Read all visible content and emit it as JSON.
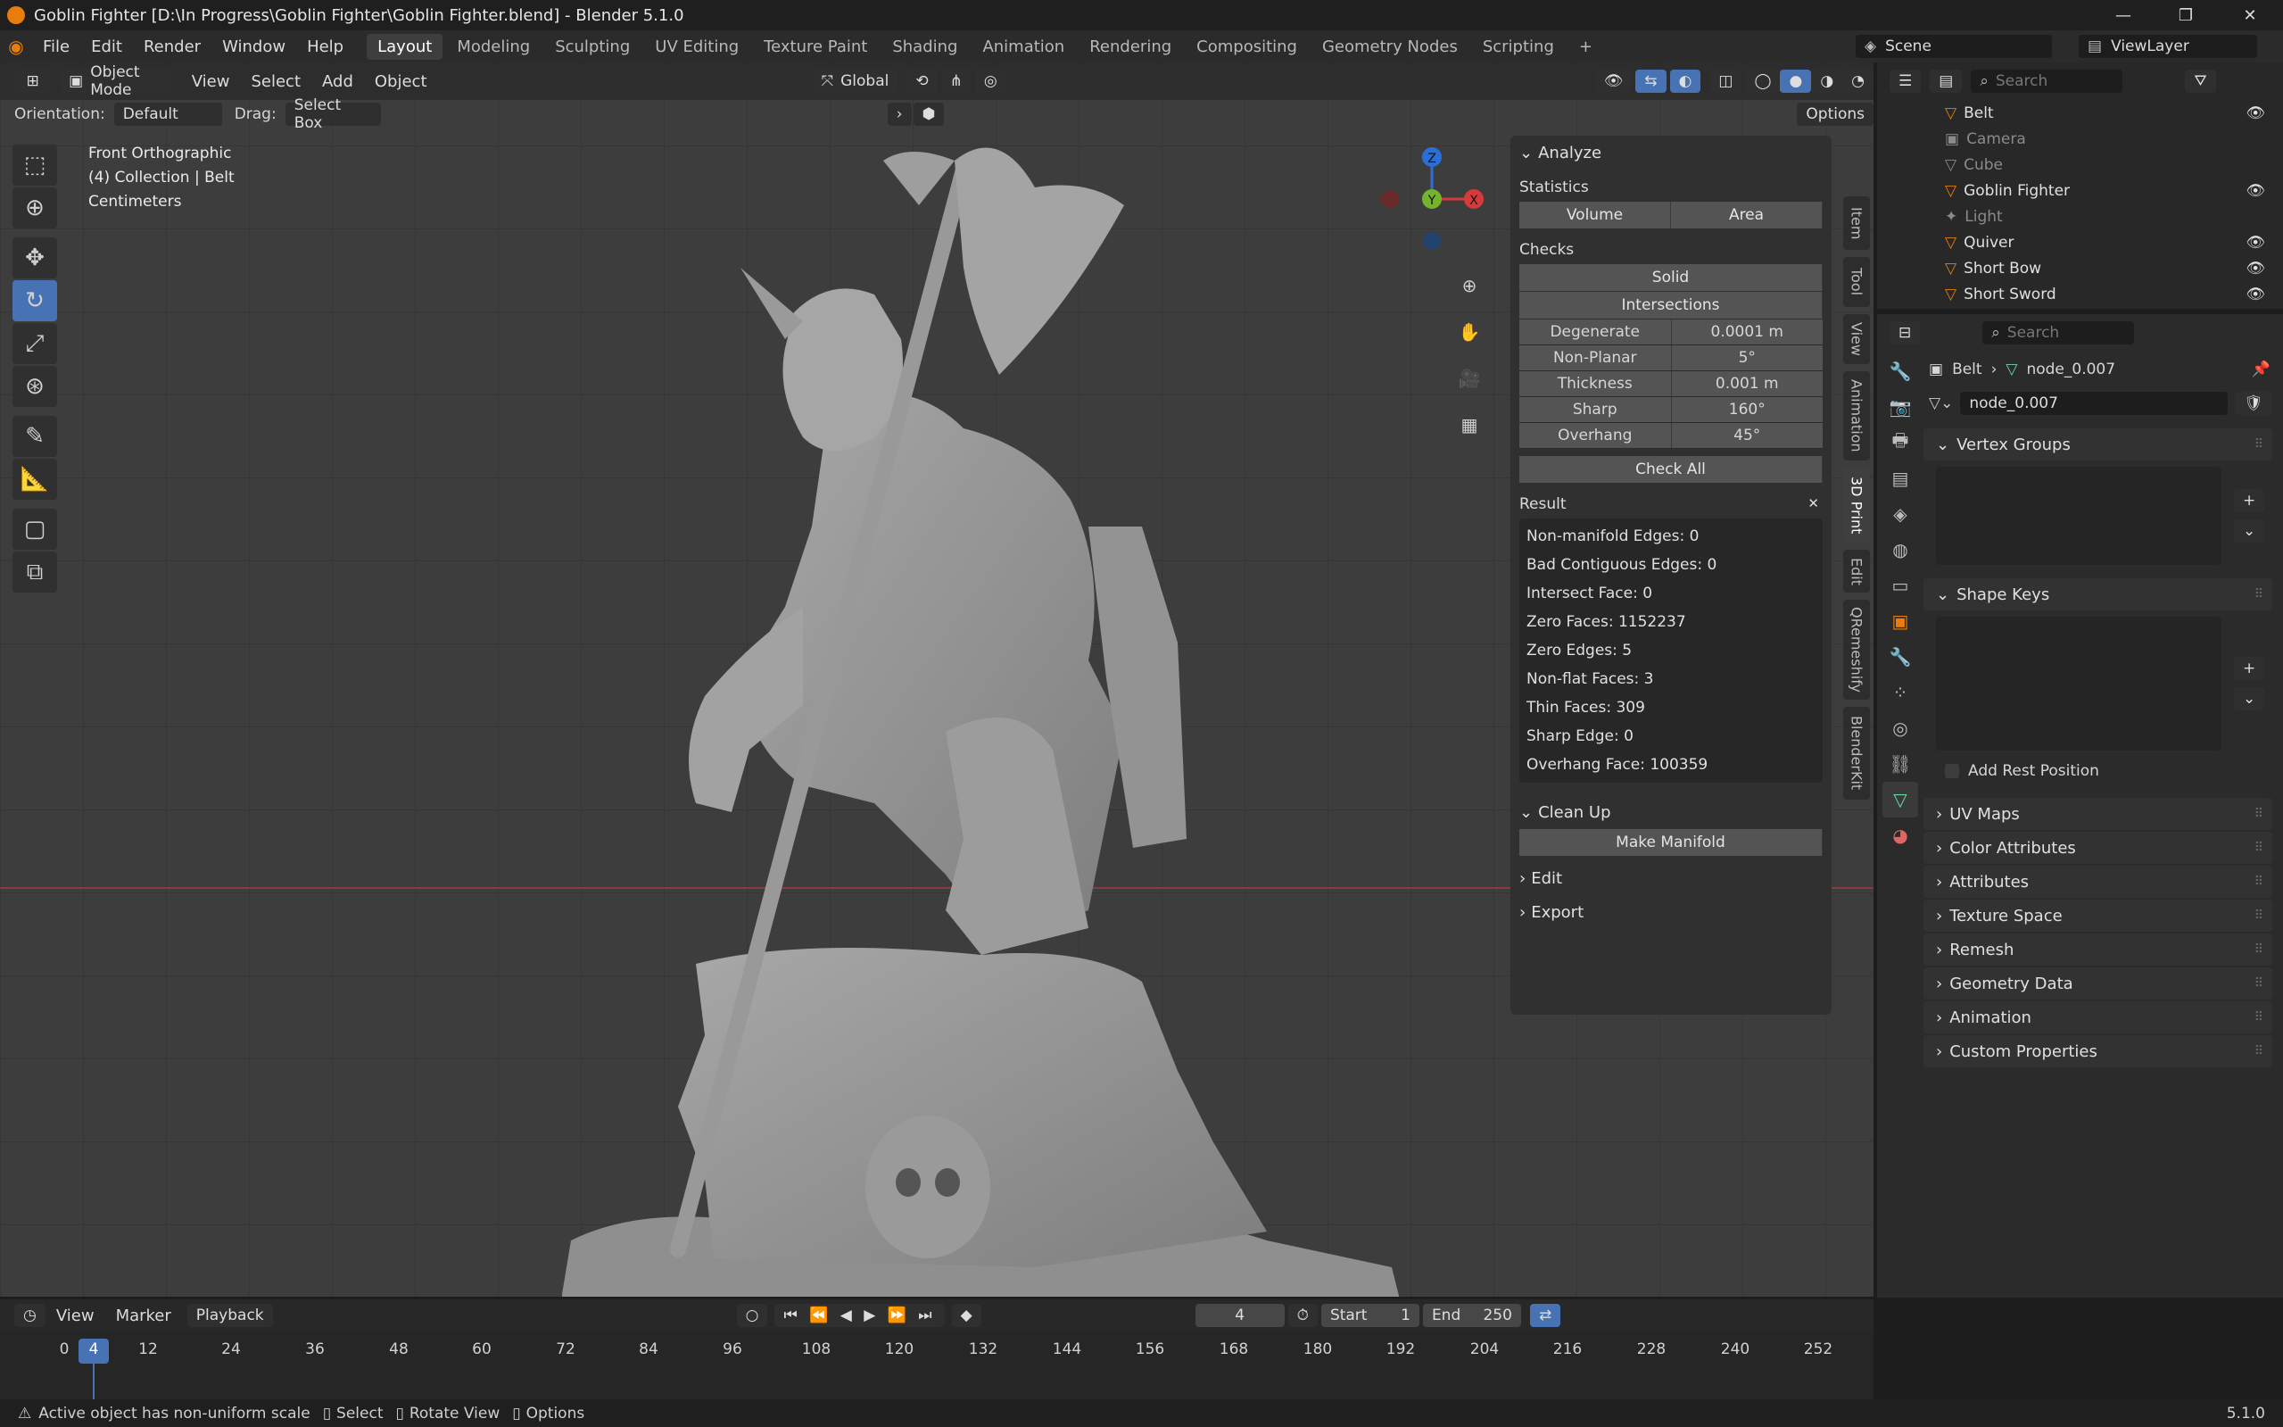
{
  "window": {
    "title": "Goblin Fighter [D:\\In Progress\\Goblin Fighter\\Goblin Fighter.blend] - Blender 5.1.0",
    "minimize": "—",
    "maximize": "❐",
    "close": "✕"
  },
  "menu": {
    "items": [
      "File",
      "Edit",
      "Render",
      "Window",
      "Help"
    ],
    "workspaces": [
      "Layout",
      "Modeling",
      "Sculpting",
      "UV Editing",
      "Texture Paint",
      "Shading",
      "Animation",
      "Rendering",
      "Compositing",
      "Geometry Nodes",
      "Scripting"
    ],
    "active_workspace": "Layout",
    "add_tab": "+",
    "scene": "Scene",
    "view_layer": "ViewLayer"
  },
  "viewport": {
    "mode": "Object Mode",
    "menus": [
      "View",
      "Select",
      "Add",
      "Object"
    ],
    "transform_orientation": "Global",
    "orientation_label": "Orientation:",
    "orientation_value": "Default",
    "drag_label": "Drag:",
    "drag_value": "Select Box",
    "options": "Options",
    "view_name": "Front Orthographic",
    "collection": "(4) Collection | Belt",
    "units": "Centimeters",
    "gizmo": {
      "z": "Z",
      "y": "Y",
      "x": "X"
    }
  },
  "npanel": {
    "analyze": "Analyze",
    "statistics": "Statistics",
    "volume": "Volume",
    "area": "Area",
    "checks": "Checks",
    "solid": "Solid",
    "intersections": "Intersections",
    "checks_rows": [
      {
        "k": "Degenerate",
        "v": "0.0001 m"
      },
      {
        "k": "Non-Planar",
        "v": "5°"
      },
      {
        "k": "Thickness",
        "v": "0.001 m"
      },
      {
        "k": "Sharp",
        "v": "160°"
      },
      {
        "k": "Overhang",
        "v": "45°"
      }
    ],
    "check_all": "Check All",
    "result": "Result",
    "results": [
      "Non-manifold Edges: 0",
      "Bad Contiguous Edges: 0",
      "Intersect Face: 0",
      "Zero Faces: 1152237",
      "Zero Edges: 5",
      "Non-flat Faces: 3",
      "Thin Faces: 309",
      "Sharp Edge: 0",
      "Overhang Face: 100359"
    ],
    "clean_up": "Clean Up",
    "make_manifold": "Make Manifold",
    "edit": "Edit",
    "export": "Export",
    "tabs": [
      "Item",
      "Tool",
      "View",
      "Animation",
      "3D Print",
      "Edit",
      "QRemeshify",
      "BlenderKit"
    ],
    "active_tab": "3D Print"
  },
  "outliner": {
    "search_placeholder": "Search",
    "items": [
      {
        "name": "Belt",
        "dim": false
      },
      {
        "name": "Camera",
        "dim": true
      },
      {
        "name": "Cube",
        "dim": true
      },
      {
        "name": "Goblin Fighter",
        "dim": false
      },
      {
        "name": "Light",
        "dim": true
      },
      {
        "name": "Quiver",
        "dim": false
      },
      {
        "name": "Short Bow",
        "dim": false
      },
      {
        "name": "Short Sword",
        "dim": false
      }
    ]
  },
  "properties": {
    "search_placeholder": "Search",
    "object": "Belt",
    "mesh": "node_0.007",
    "mesh_field": "node_0.007",
    "vertex_groups": "Vertex Groups",
    "shape_keys": "Shape Keys",
    "add_rest_position": "Add Rest Position",
    "sections": [
      "UV Maps",
      "Color Attributes",
      "Attributes",
      "Texture Space",
      "Remesh",
      "Geometry Data",
      "Animation",
      "Custom Properties"
    ]
  },
  "timeline": {
    "menus": [
      "View",
      "Marker",
      "Playback"
    ],
    "current_frame": "4",
    "start_label": "Start",
    "start": "1",
    "end_label": "End",
    "end": "250",
    "ticks": [
      "0",
      "4",
      "12",
      "24",
      "36",
      "48",
      "60",
      "72",
      "84",
      "96",
      "108",
      "120",
      "132",
      "144",
      "156",
      "168",
      "180",
      "192",
      "204",
      "216",
      "228",
      "240",
      "252"
    ]
  },
  "status": {
    "warning": "Active object has non-uniform scale",
    "select": "Select",
    "rotate": "Rotate View",
    "options": "Options",
    "version": "5.1.0"
  }
}
